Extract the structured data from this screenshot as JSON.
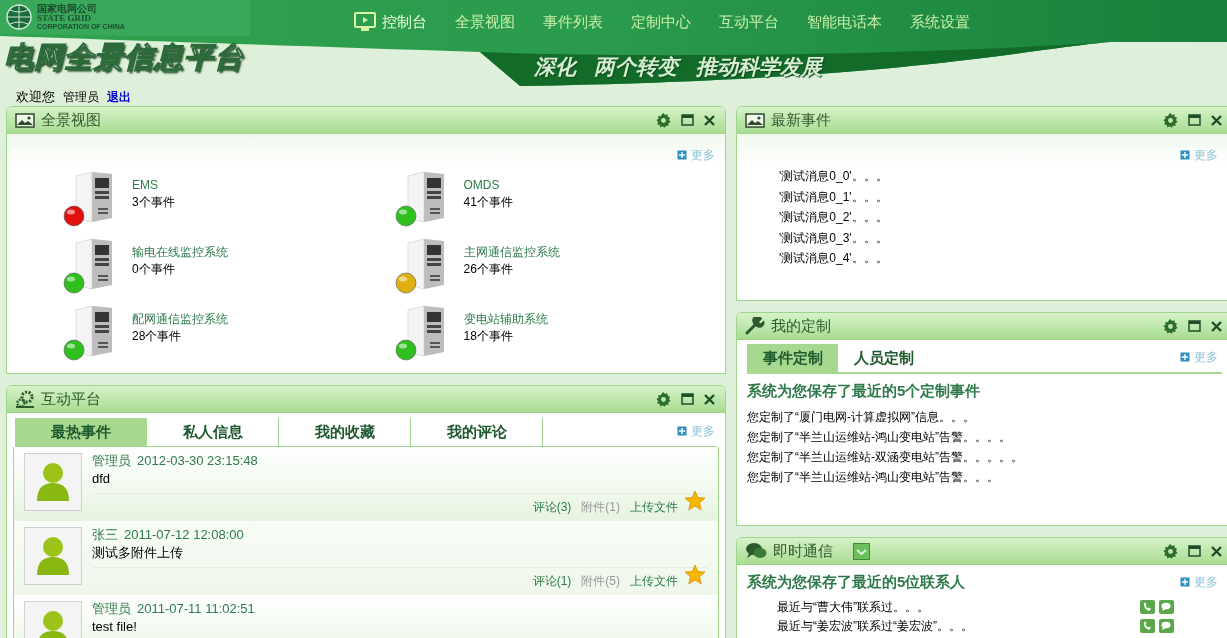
{
  "header": {
    "logo": {
      "cn": "国家电网公司",
      "en": "STATE GRID",
      "sub": "CORPORATION OF CHINA"
    },
    "site_title": "电网全景信息平台",
    "slogan": [
      "深化",
      "两个转变",
      "推动科学发展"
    ],
    "nav": [
      {
        "label": "控制台",
        "selected": true
      },
      {
        "label": "全景视图",
        "selected": false
      },
      {
        "label": "事件列表",
        "selected": false
      },
      {
        "label": "定制中心",
        "selected": false
      },
      {
        "label": "互动平台",
        "selected": false
      },
      {
        "label": "智能电话本",
        "selected": false
      },
      {
        "label": "系统设置",
        "selected": false
      }
    ]
  },
  "welcome": {
    "greeting": "欢迎您",
    "user": "管理员",
    "logout": "退出"
  },
  "panorama": {
    "title": "全景视图",
    "more": "更多",
    "systems": [
      {
        "name": "EMS",
        "events": "3个事件",
        "color": "#e01010"
      },
      {
        "name": "OMDS",
        "events": "41个事件",
        "color": "#2fbf1f"
      },
      {
        "name": "输电在线监控系统",
        "events": "0个事件",
        "color": "#2fbf1f"
      },
      {
        "name": "主网通信监控系统",
        "events": "26个事件",
        "color": "#e0b010"
      },
      {
        "name": "配网通信监控系统",
        "events": "28个事件",
        "color": "#2fbf1f"
      },
      {
        "name": "变电站辅助系统",
        "events": "18个事件",
        "color": "#2fbf1f"
      }
    ]
  },
  "interaction": {
    "title": "互动平台",
    "more": "更多",
    "tabs": [
      {
        "label": "最热事件",
        "selected": true
      },
      {
        "label": "私人信息",
        "selected": false
      },
      {
        "label": "我的收藏",
        "selected": false
      },
      {
        "label": "我的评论",
        "selected": false
      }
    ],
    "posts": [
      {
        "author": "管理员",
        "time": "2012-03-30 23:15:48",
        "content": "dfd",
        "comments": "评论(3)",
        "attachments": "附件(1)",
        "upload": "上传文件"
      },
      {
        "author": "张三",
        "time": "2011-07-12 12:08:00",
        "content": "测试多附件上传",
        "comments": "评论(1)",
        "attachments": "附件(5)",
        "upload": "上传文件"
      },
      {
        "author": "管理员",
        "time": "2011-07-11 11:02:51",
        "content": "test file!"
      }
    ]
  },
  "latest_events": {
    "title": "最新事件",
    "more": "更多",
    "items": [
      "'测试消息0_0'。。。",
      "'测试消息0_1'。。。",
      "'测试消息0_2'。。。",
      "'测试消息0_3'。。。",
      "'测试消息0_4'。。。"
    ]
  },
  "my_custom": {
    "title": "我的定制",
    "more": "更多",
    "tabs": [
      {
        "label": "事件定制",
        "selected": true
      },
      {
        "label": "人员定制",
        "selected": false
      }
    ],
    "heading": "系统为您保存了最近的5个定制事件",
    "items": [
      "您定制了“厦门电网-计算虚拟网”信息。。。",
      "您定制了“半兰山运维站-鸿山变电站”告警。。。。",
      "您定制了“半兰山运维站-双涵变电站”告警。。。。。",
      "您定制了“半兰山运维站-鸿山变电站”告警。。。"
    ]
  },
  "instant_messaging": {
    "title": "即时通信",
    "more": "更多",
    "heading": "系统为您保存了最近的5位联系人",
    "contacts": [
      "最近与“曹大伟”联系过。。。",
      "最近与“姜宏波”联系过“姜宏波”。。。"
    ]
  }
}
